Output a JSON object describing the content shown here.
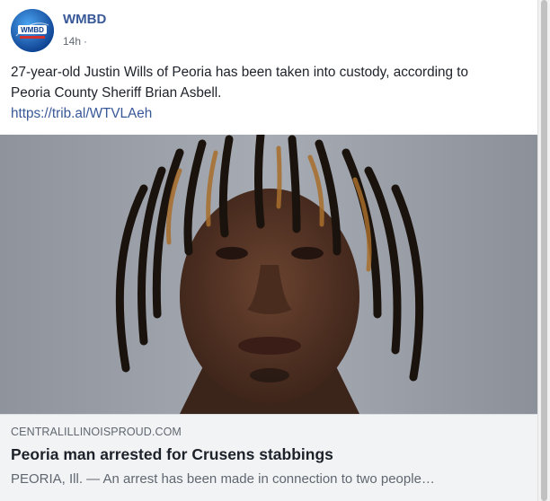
{
  "post": {
    "page_name": "WMBD",
    "avatar_text": "WMBD",
    "time": "14h",
    "separator": "·",
    "text_line1": "27-year-old Justin Wills of Peoria has been taken into custody, according to",
    "text_line2": "Peoria County Sheriff Brian Asbell.",
    "link": "https://trib.al/WTVLAeh"
  },
  "link_preview": {
    "domain": "CENTRALILLINOISPROUD.COM",
    "headline": "Peoria man arrested for Crusens stabbings",
    "description": "PEORIA, Ill. — An arrest has been made in connection to two people…"
  },
  "colors": {
    "link": "#385898",
    "text": "#1d2129",
    "preview_bg": "#f2f3f5"
  }
}
